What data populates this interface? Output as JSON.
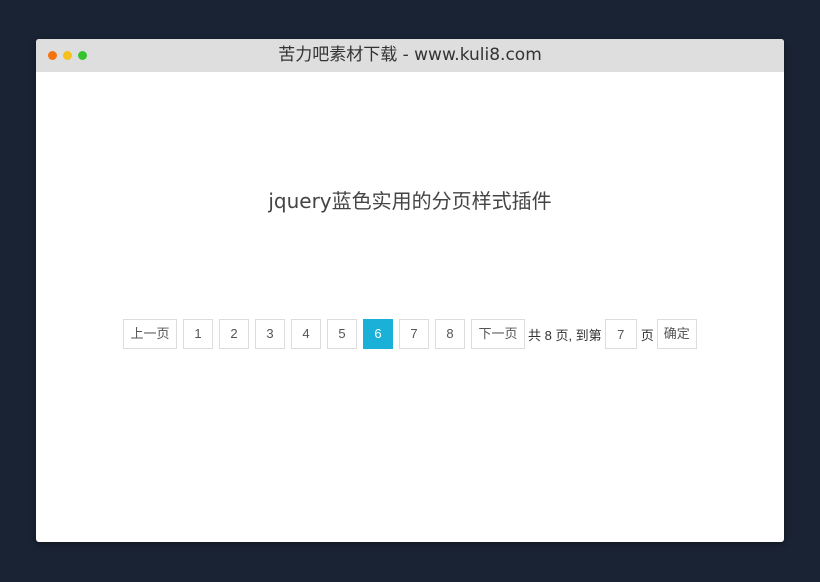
{
  "window": {
    "title": "苦力吧素材下载 - www.kuli8.com"
  },
  "page": {
    "heading": "jquery蓝色实用的分页样式插件"
  },
  "pagination": {
    "prev_label": "上一页",
    "next_label": "下一页",
    "pages": [
      "1",
      "2",
      "3",
      "4",
      "5",
      "6",
      "7",
      "8"
    ],
    "current_page": "6",
    "total_text": "共 8 页, 到第",
    "jump_value": "7",
    "unit_text": "页",
    "confirm_label": "确定"
  },
  "colors": {
    "background": "#1a2333",
    "titlebar": "#dedede",
    "active_page": "#1ab0d8",
    "dot_red": "#f5730f",
    "dot_yellow": "#f4c01c",
    "dot_green": "#35c42f"
  }
}
